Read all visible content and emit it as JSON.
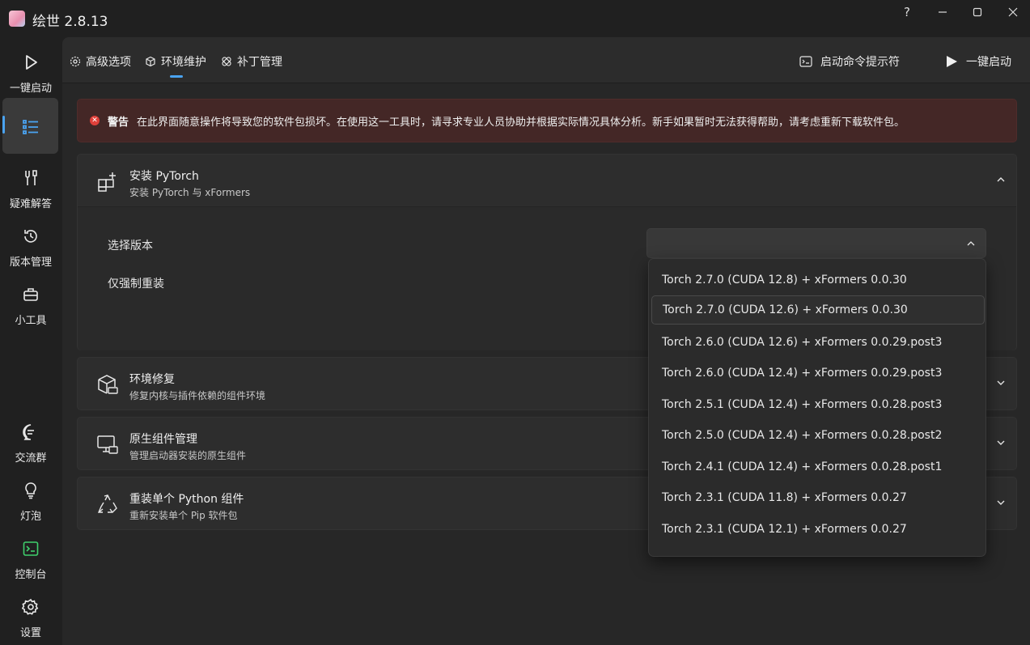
{
  "window": {
    "title": "绘世 2.8.13",
    "help": "?"
  },
  "nav": {
    "items": [
      {
        "label": "一键启动"
      },
      {
        "label": ""
      },
      {
        "label": "疑难解答"
      },
      {
        "label": "版本管理"
      },
      {
        "label": "小工具"
      },
      {
        "label": "交流群"
      },
      {
        "label": "灯泡"
      },
      {
        "label": "控制台"
      },
      {
        "label": "设置"
      }
    ],
    "accent": "#4aa3f0"
  },
  "tabs": [
    {
      "label": "高级选项"
    },
    {
      "label": "环境维护"
    },
    {
      "label": "补丁管理"
    }
  ],
  "actions": {
    "console_prompt": "启动命令提示符",
    "launch": "一键启动"
  },
  "warning": {
    "title": "警告",
    "text": "在此界面随意操作将导致您的软件包损坏。在使用这一工具时，请寻求专业人员协助并根据实际情况具体分析。新手如果暂时无法获得帮助，请考虑重新下载软件包。"
  },
  "cards": [
    {
      "title": "安装 PyTorch",
      "subtitle": "安装 PyTorch 与 xFormers",
      "expanded": true
    },
    {
      "title": "环境修复",
      "subtitle": "修复内核与插件依赖的组件环境"
    },
    {
      "title": "原生组件管理",
      "subtitle": "管理启动器安装的原生组件"
    },
    {
      "title": "重装单个 Python 组件",
      "subtitle": "重新安装单个 Pip 软件包"
    }
  ],
  "pytorch": {
    "select_version_label": "选择版本",
    "force_reinstall_label": "仅强制重装",
    "selected": ""
  },
  "dropdown": {
    "options": [
      "Torch 2.7.0 (CUDA 12.8) + xFormers 0.0.30",
      "Torch 2.7.0 (CUDA 12.6) + xFormers 0.0.30",
      "Torch 2.6.0 (CUDA 12.6) + xFormers 0.0.29.post3",
      "Torch 2.6.0 (CUDA 12.4) + xFormers 0.0.29.post3",
      "Torch 2.5.1 (CUDA 12.4) + xFormers 0.0.28.post3",
      "Torch 2.5.0 (CUDA 12.4) + xFormers 0.0.28.post2",
      "Torch 2.4.1 (CUDA 12.4) + xFormers 0.0.28.post1",
      "Torch 2.3.1 (CUDA 11.8) + xFormers 0.0.27",
      "Torch 2.3.1 (CUDA 12.1) + xFormers 0.0.27"
    ],
    "highlighted_index": 1
  }
}
